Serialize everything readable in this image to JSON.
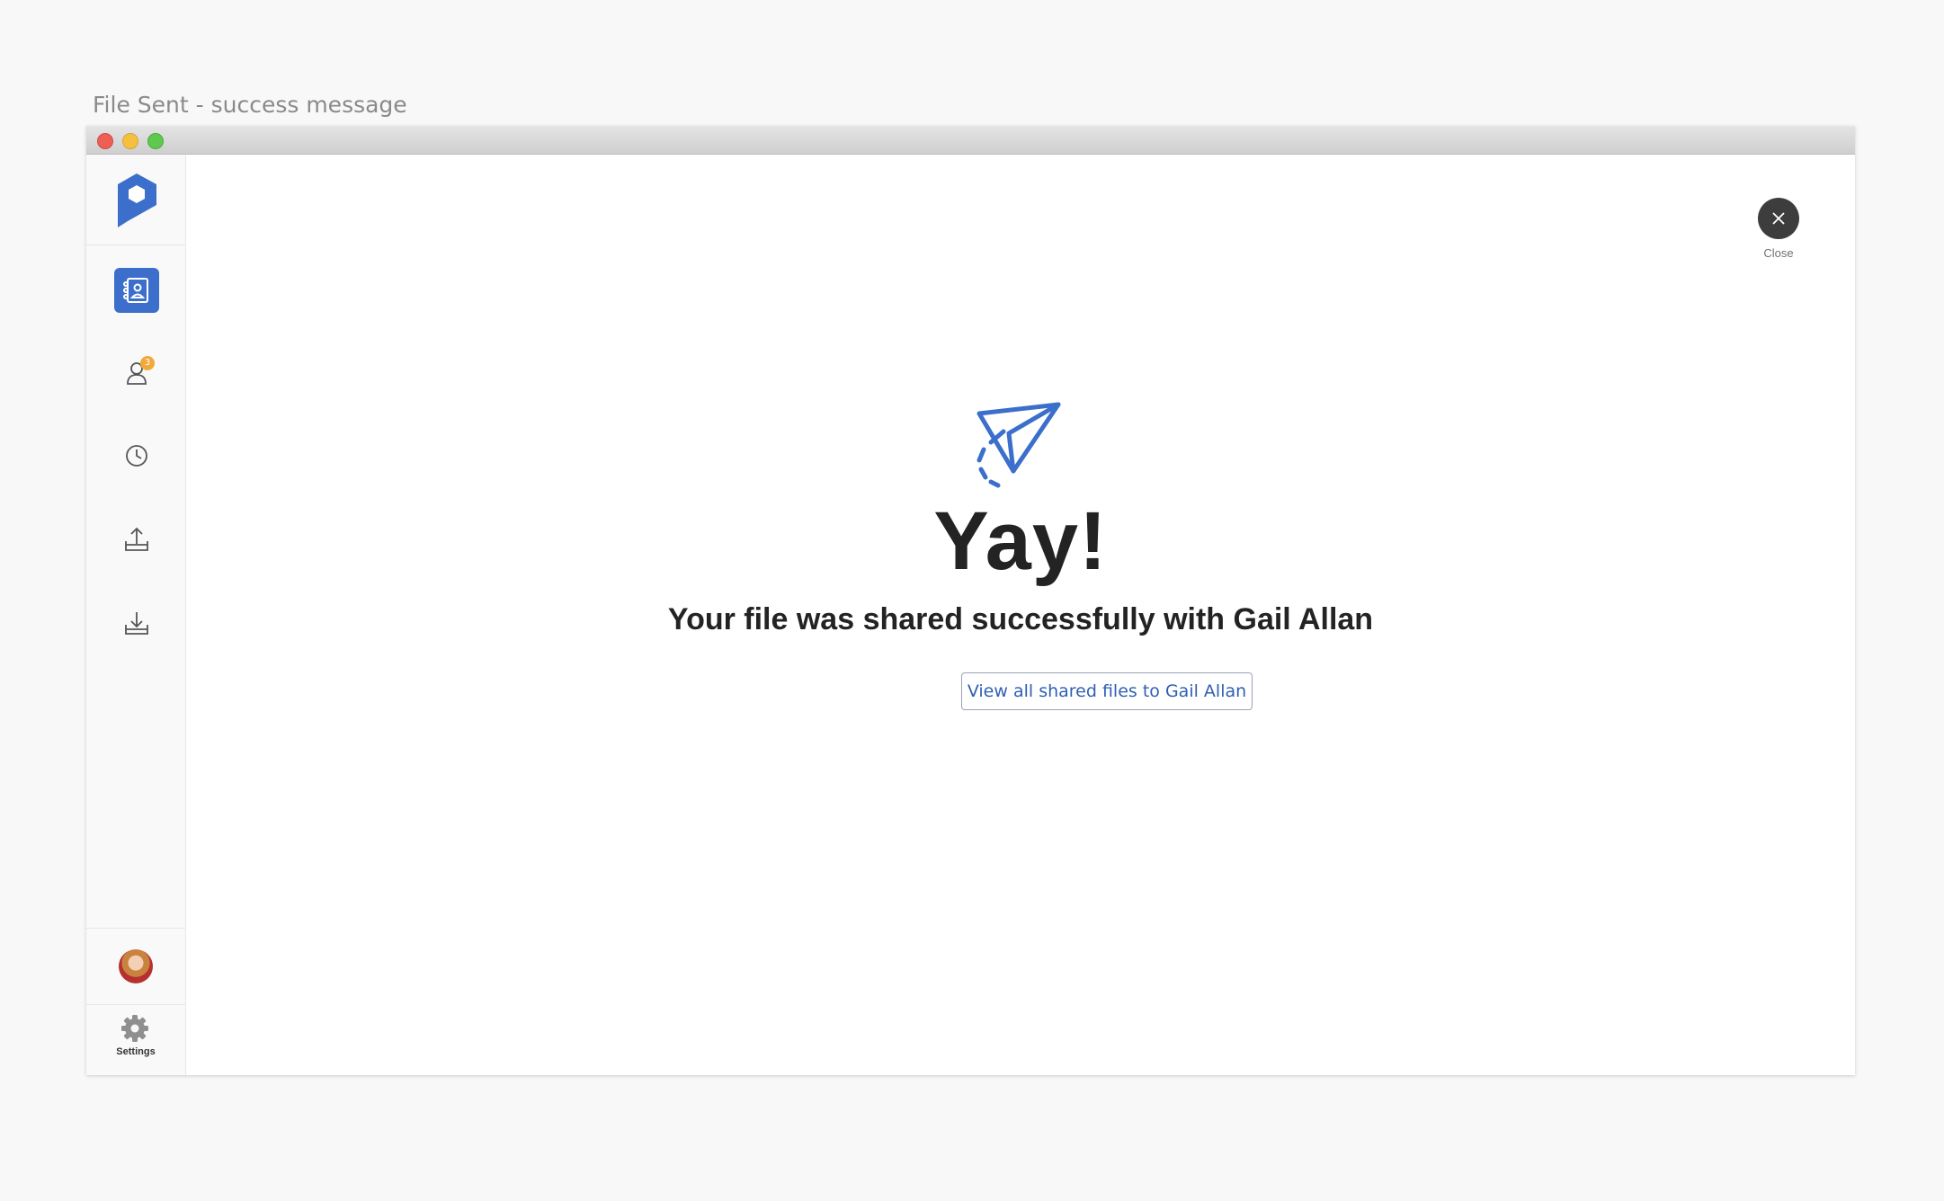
{
  "frame_caption": "File Sent - success message",
  "colors": {
    "accent": "#3b6fcb",
    "badge": "#f2a93b",
    "close_bg": "#3d3d3d"
  },
  "sidebar": {
    "items": [
      {
        "icon": "contacts-book-icon",
        "active": true
      },
      {
        "icon": "user-icon",
        "badge": "3"
      },
      {
        "icon": "clock-icon"
      },
      {
        "icon": "upload-icon"
      },
      {
        "icon": "download-icon"
      }
    ],
    "settings_label": "Settings"
  },
  "close": {
    "label": "Close"
  },
  "success": {
    "heading": "Yay!",
    "message": "Your file was shared successfully with Gail Allan",
    "button_label": "View all shared files to Gail Allan"
  }
}
